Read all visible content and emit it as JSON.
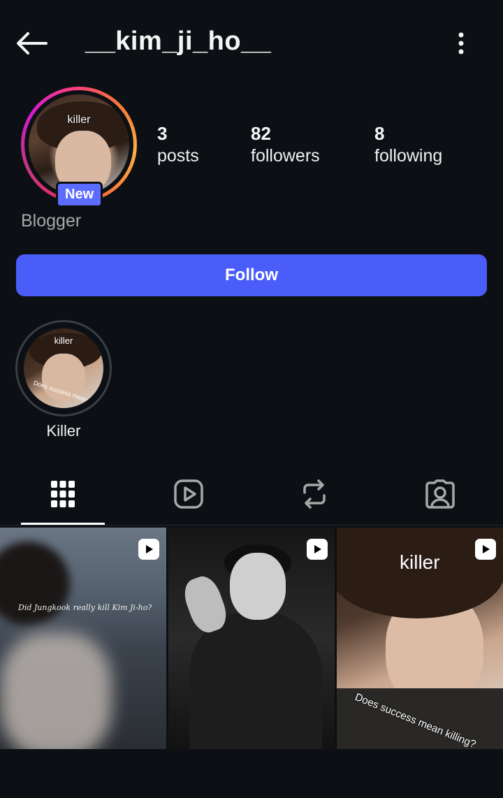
{
  "header": {
    "username": "__kim_ji_ho__",
    "back_icon": "arrow-left-icon",
    "more_icon": "more-vertical-icon"
  },
  "profile": {
    "avatar_text": "killer",
    "new_badge": "New",
    "bio": "Blogger",
    "stats": [
      {
        "count": "3",
        "label": "posts"
      },
      {
        "count": "82",
        "label": "followers"
      },
      {
        "count": "8",
        "label": "following"
      }
    ],
    "follow_label": "Follow"
  },
  "highlights": [
    {
      "label": "Killer",
      "cover_text_top": "killer",
      "cover_text_bottom": "Does success mean k"
    }
  ],
  "tabs": [
    {
      "icon": "grid-icon",
      "active": true
    },
    {
      "icon": "reels-icon",
      "active": false
    },
    {
      "icon": "repost-icon",
      "active": false
    },
    {
      "icon": "tagged-icon",
      "active": false
    }
  ],
  "posts": [
    {
      "type": "reel",
      "caption": "Did Jungkook really kill Kim Ji-ho?"
    },
    {
      "type": "reel",
      "caption": ""
    },
    {
      "type": "reel",
      "caption_top": "killer",
      "caption_bottom": "Does success mean killing?"
    }
  ],
  "colors": {
    "background": "#0c1014",
    "follow_button": "#4a5df9",
    "badge": "#5b6cff",
    "muted_text": "#a8a8a8"
  }
}
